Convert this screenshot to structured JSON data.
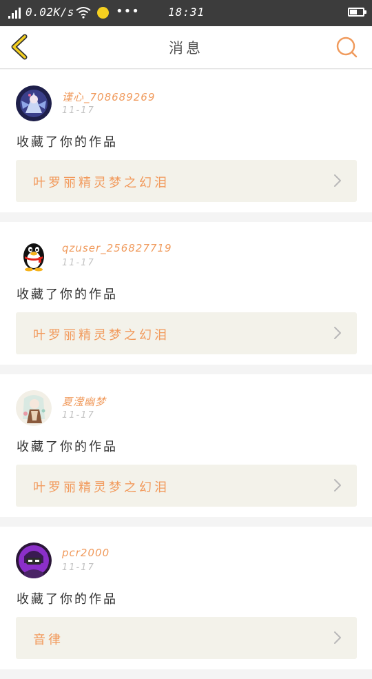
{
  "status_bar": {
    "net_speed": "0.02K/s",
    "more": "•••",
    "time": "18:31",
    "colors": {
      "background": "#3c3c3c",
      "notify_dot": "#f5d020"
    }
  },
  "header": {
    "title": "消息",
    "back_icon": "chevron-left-icon",
    "search_icon": "search-icon",
    "colors": {
      "back": "#f5d020",
      "search": "#f09a5c"
    }
  },
  "messages": [
    {
      "username": "谨心_708689269",
      "date": "11-17",
      "action": "收藏了你的作品",
      "work_title": "叶罗丽精灵梦之幻泪",
      "avatar": "anime-avatar-icon"
    },
    {
      "username": "qzuser_256827719",
      "date": "11-17",
      "action": "收藏了你的作品",
      "work_title": "叶罗丽精灵梦之幻泪",
      "avatar": "qq-penguin-avatar-icon"
    },
    {
      "username": "夏滢幽梦",
      "date": "11-17",
      "action": "收藏了你的作品",
      "work_title": "叶罗丽精灵梦之幻泪",
      "avatar": "anime-girl-avatar-icon"
    },
    {
      "username": "pcr2000",
      "date": "11-17",
      "action": "收藏了你的作品",
      "work_title": "音律",
      "avatar": "purple-character-avatar-icon"
    }
  ],
  "colors": {
    "accent": "#f09a5c",
    "link_background": "#f3f2ea",
    "page_background": "#f4f4f4"
  }
}
